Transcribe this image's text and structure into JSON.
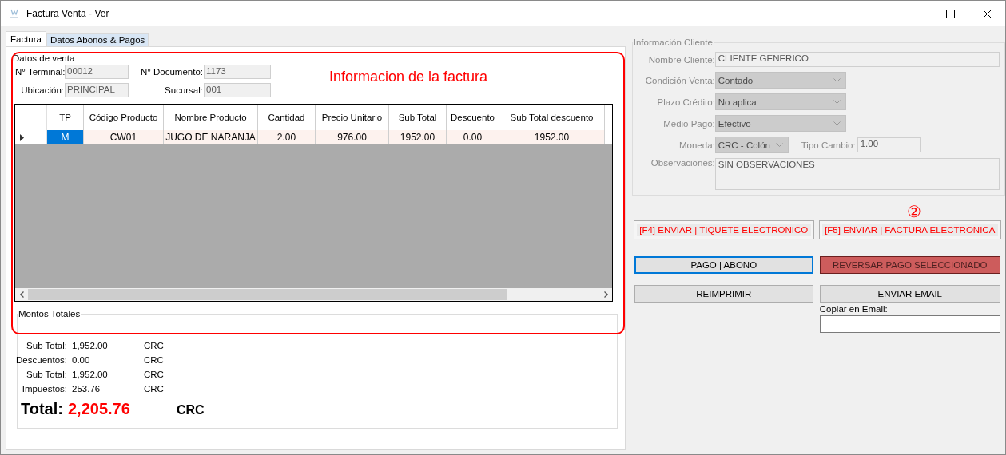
{
  "window": {
    "title": "Factura Venta - Ver"
  },
  "tabs": [
    {
      "label": "Factura",
      "selected": true
    },
    {
      "label": "Datos Abonos & Pagos",
      "selected": false
    }
  ],
  "datos_venta": {
    "title": "Datos de venta",
    "fields": [
      {
        "label": "N° Terminal:",
        "value": "00012"
      },
      {
        "label": "N° Documento:",
        "value": "1173"
      },
      {
        "label": "Ubicación:",
        "value": "PRINCIPAL"
      },
      {
        "label": "Sucursal:",
        "value": "001"
      }
    ]
  },
  "annotation_title": "Informacion de la factura",
  "table": {
    "columns": [
      "TP",
      "Código Producto",
      "Nombre Producto",
      "Cantidad",
      "Precio Unitario",
      "Sub Total",
      "Descuento",
      "Sub Total descuento"
    ],
    "rows": [
      {
        "current": true,
        "cells": [
          {
            "text": "M",
            "selected": true
          },
          {
            "text": "CW01",
            "selected": false
          },
          {
            "text": "JUGO DE NARANJA",
            "selected": false
          },
          {
            "text": "2.00",
            "selected": false
          },
          {
            "text": "976.00",
            "selected": false
          },
          {
            "text": "1952.00",
            "selected": false
          },
          {
            "text": "0.00",
            "selected": false
          },
          {
            "text": "1952.00",
            "selected": false
          }
        ]
      }
    ]
  },
  "montos": {
    "title": "Montos Totales",
    "rows": [
      {
        "label": "Sub Total:",
        "value": "1,952.00",
        "currency": "CRC"
      },
      {
        "label": "Descuentos:",
        "value": "0.00",
        "currency": "CRC"
      },
      {
        "label": "Sub Total:",
        "value": "1,952.00",
        "currency": "CRC"
      },
      {
        "label": "Impuestos:",
        "value": "253.76",
        "currency": "CRC"
      }
    ],
    "total": {
      "label": "Total:",
      "value": "2,205.76",
      "currency": "CRC"
    }
  },
  "cliente": {
    "title": "Información Cliente",
    "fields": [
      {
        "kind": "text",
        "label": "Nombre Cliente:",
        "value": "CLIENTE GENERICO"
      },
      {
        "kind": "combo",
        "label": "Condición Venta:",
        "value": "Contado"
      },
      {
        "kind": "combo",
        "label": "Plazo Crédito:",
        "value": "No aplica"
      },
      {
        "kind": "combo",
        "label": "Medio Pago:",
        "value": "Efectivo"
      },
      {
        "kind": "pair",
        "label": "Moneda:",
        "value": "CRC - Colón",
        "label2": "Tipo Cambio:",
        "value2": "1.00"
      },
      {
        "kind": "memo",
        "label": "Observaciones:",
        "value": "SIN OBSERVACIONES"
      }
    ]
  },
  "annotation_marker": "②",
  "buttons": [
    {
      "label": "[F4] ENVIAR | TIQUETE ELECTRONICO",
      "kind": "alert"
    },
    {
      "label": "[F5] ENVIAR | FACTURA ELECTRONICA",
      "kind": "alert"
    },
    {
      "label": "PAGO | ABONO",
      "kind": "focused"
    },
    {
      "label": "REVERSAR PAGO SELECCIONADO",
      "kind": "danger"
    },
    {
      "label": "REIMPRIMIR",
      "kind": "normal"
    },
    {
      "label": "ENVIAR EMAIL",
      "kind": "normal"
    }
  ],
  "copy_email": {
    "label": "Copiar en Email:"
  }
}
